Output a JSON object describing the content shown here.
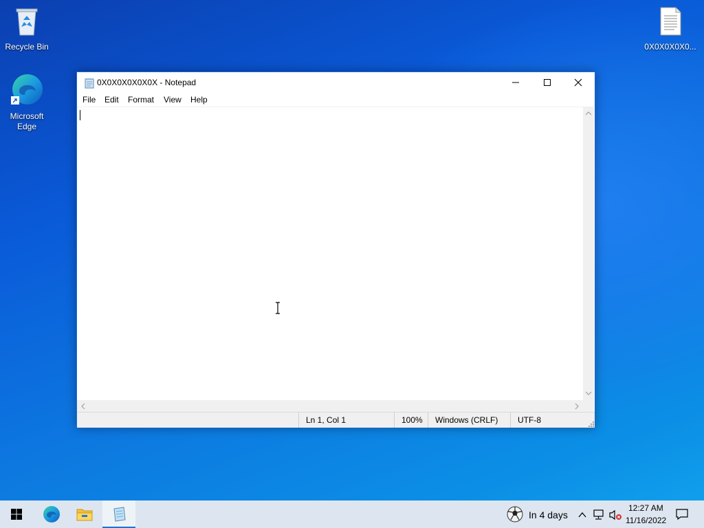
{
  "desktop": {
    "icons": [
      {
        "label": "Recycle Bin"
      },
      {
        "label": "Microsoft Edge"
      },
      {
        "label": "0X0X0X0X0..."
      }
    ]
  },
  "notepad": {
    "title": "0X0X0X0X0X0X - Notepad",
    "menu": [
      "File",
      "Edit",
      "Format",
      "View",
      "Help"
    ],
    "content": "",
    "status": {
      "position": "Ln 1, Col 1",
      "zoom": "100%",
      "line_ending": "Windows (CRLF)",
      "encoding": "UTF-8"
    }
  },
  "taskbar": {
    "weather": "In 4 days",
    "time": "12:27 AM",
    "date": "11/16/2022"
  },
  "colors": {
    "accent": "#1a73d9",
    "desktop_bg": "#0a5ad8"
  }
}
